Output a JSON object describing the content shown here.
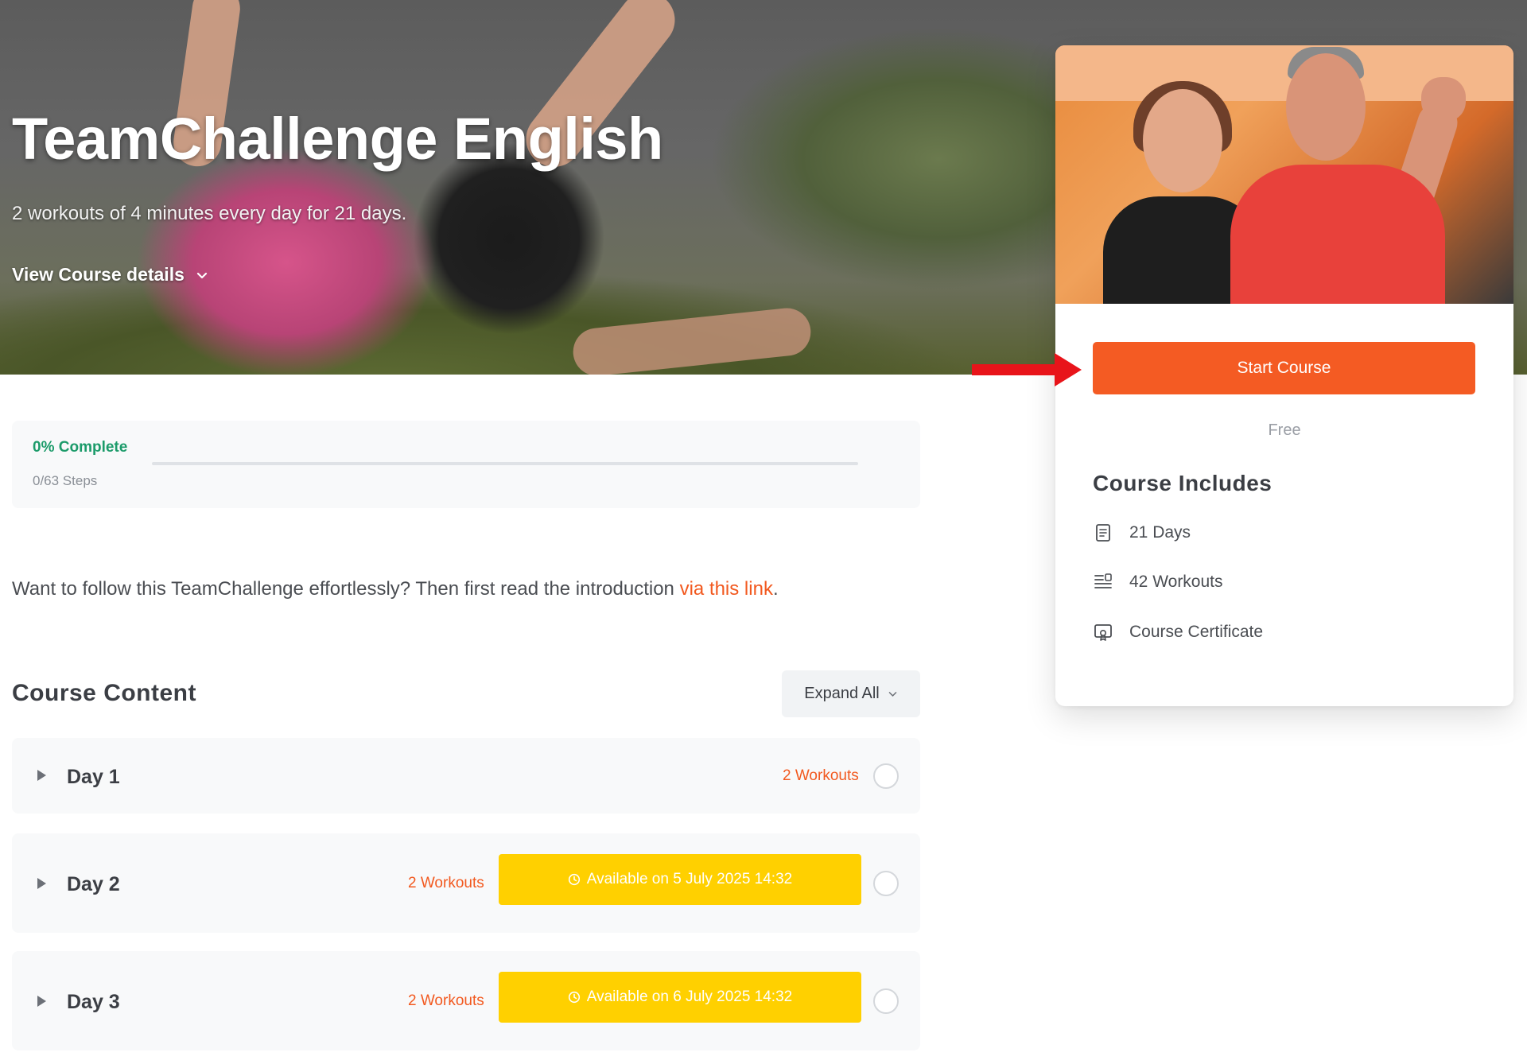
{
  "hero": {
    "title": "TeamChallenge English",
    "subtitle": "2 workouts of 4 minutes every day for 21 days.",
    "details_label": "View Course details"
  },
  "progress": {
    "percent_label": "0% Complete",
    "steps_label": "0/63 Steps",
    "fraction": 0
  },
  "intro": {
    "text": "Want to follow this TeamChallenge effortlessly? Then first read the introduction ",
    "link_label": "via this link",
    "suffix": "."
  },
  "course_content": {
    "title": "Course Content",
    "expand_label": "Expand All",
    "days": [
      {
        "label": "Day 1",
        "workouts": "2 Workouts",
        "available": ""
      },
      {
        "label": "Day 2",
        "workouts": "2 Workouts",
        "available": "Available on 5 July 2025 14:32"
      },
      {
        "label": "Day 3",
        "workouts": "2 Workouts",
        "available": "Available on 6 July 2025 14:32"
      }
    ]
  },
  "sidebar": {
    "start_label": "Start Course",
    "price": "Free",
    "includes_title": "Course Includes",
    "includes": [
      {
        "icon": "book-icon",
        "label": "21 Days"
      },
      {
        "icon": "list-icon",
        "label": "42 Workouts"
      },
      {
        "icon": "certificate-icon",
        "label": "Course Certificate"
      }
    ]
  },
  "colors": {
    "accent": "#f45b23",
    "complete": "#1c9b6a",
    "available": "#ffd000",
    "arrow": "#e8141a"
  }
}
